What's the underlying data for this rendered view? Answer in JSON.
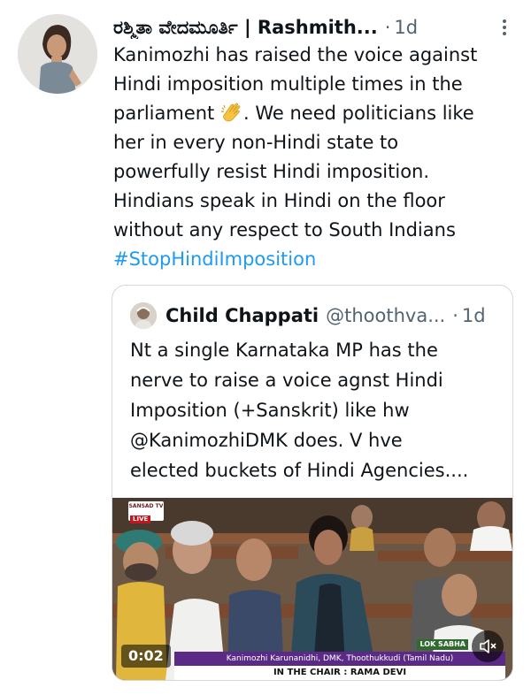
{
  "tweet": {
    "author_name": "ರಶ್ಮಿತಾ ವೇದಮೂರ್ತಿ | Rashmith...",
    "separator": "·",
    "time": "1d",
    "more_icon": "more-vertical-icon",
    "text_lines": [
      "Kanimozhi has raised the voice against",
      "Hindi imposition multiple times in the",
      "parliament",
      ". We need politicians like",
      "her in every non-Hindi state to",
      "powerfully resist Hindi imposition.",
      "Hindians speak in Hindi on the floor",
      "without any respect to South Indians"
    ],
    "emoji": "clapping-hands-icon",
    "hashtag": "#StopHindiImposition"
  },
  "quote": {
    "author_name": "Child Chappati",
    "handle": "@thoothva...",
    "separator": "·",
    "time": "1d",
    "text_lines": [
      "Nt a single Karnataka MP has the",
      "nerve to raise a voice agnst Hindi",
      "Imposition (+Sanskrit) like hw",
      "@KanimozhiDMK does. V hve",
      "elected buckets of Hindi Agencies...."
    ],
    "video": {
      "timer": "0:02",
      "caption": "Kanimozhi Karunanidhi, DMK, Thoothukkudi (Tamil Nadu)",
      "chair": "IN THE CHAIR : RAMA DEVI",
      "channel": "SANSAD TV",
      "live": "LIVE",
      "lok_tag": "LOK SABHA",
      "mute_icon": "volume-muted-icon"
    }
  },
  "colors": {
    "text": "#0f1419",
    "secondary": "#536471",
    "link": "#1d9bf0",
    "border": "#cfd9de",
    "caption_bar": "#5b2a86"
  }
}
